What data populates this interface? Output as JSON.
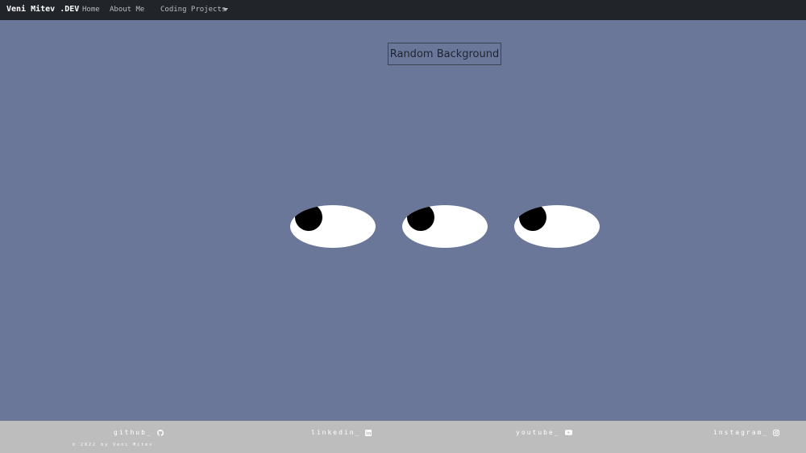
{
  "navbar": {
    "brand": "Veni Mitev .DEV",
    "links": [
      {
        "label": "Home"
      },
      {
        "label": "About Me"
      },
      {
        "label": "Coding Projects",
        "has_dropdown": true
      }
    ]
  },
  "main": {
    "random_button_label": "Random Background",
    "background_color": "#6a7799",
    "eyes_count": 3
  },
  "footer": {
    "background_color": "#bdbdbd",
    "socials": [
      {
        "label": "github_",
        "icon": "github-icon"
      },
      {
        "label": "linkedin_",
        "icon": "linkedin-icon"
      },
      {
        "label": "youtube_",
        "icon": "youtube-icon"
      },
      {
        "label": "instagram_",
        "icon": "instagram-icon"
      }
    ],
    "copyright": "© 2022 by Veni Mitev"
  }
}
